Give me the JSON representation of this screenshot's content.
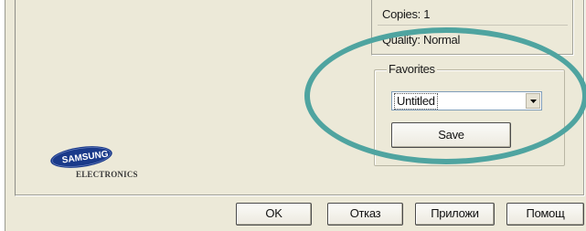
{
  "summary": {
    "copies_label": "Copies: 1",
    "quality_label": "Quality: Normal"
  },
  "favorites": {
    "legend": "Favorites",
    "selected_value": "Untitled",
    "save_label": "Save"
  },
  "logo": {
    "brand": "SAMSUNG",
    "subtitle": "ELECTRONICS"
  },
  "buttons": {
    "ok": "OK",
    "cancel": "Отказ",
    "apply": "Приложи",
    "help": "Помощ"
  },
  "colors": {
    "dialog_bg": "#ece9d8",
    "highlight_ring": "#4fa4a0",
    "logo_blue": "#1a3a8a"
  }
}
